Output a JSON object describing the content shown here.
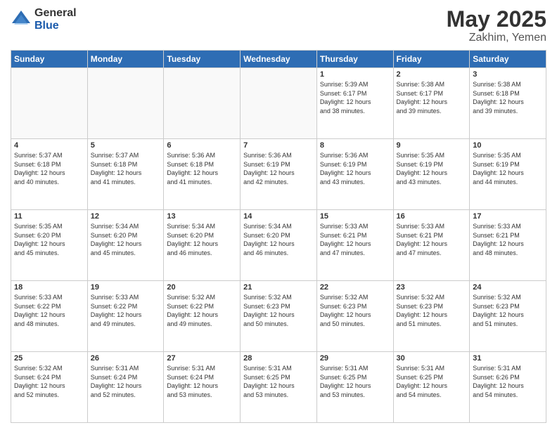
{
  "logo": {
    "general": "General",
    "blue": "Blue"
  },
  "title": "May 2025",
  "subtitle": "Zakhim, Yemen",
  "days": [
    "Sunday",
    "Monday",
    "Tuesday",
    "Wednesday",
    "Thursday",
    "Friday",
    "Saturday"
  ],
  "weeks": [
    [
      {
        "day": "",
        "info": ""
      },
      {
        "day": "",
        "info": ""
      },
      {
        "day": "",
        "info": ""
      },
      {
        "day": "",
        "info": ""
      },
      {
        "day": "1",
        "info": "Sunrise: 5:39 AM\nSunset: 6:17 PM\nDaylight: 12 hours\nand 38 minutes."
      },
      {
        "day": "2",
        "info": "Sunrise: 5:38 AM\nSunset: 6:17 PM\nDaylight: 12 hours\nand 39 minutes."
      },
      {
        "day": "3",
        "info": "Sunrise: 5:38 AM\nSunset: 6:18 PM\nDaylight: 12 hours\nand 39 minutes."
      }
    ],
    [
      {
        "day": "4",
        "info": "Sunrise: 5:37 AM\nSunset: 6:18 PM\nDaylight: 12 hours\nand 40 minutes."
      },
      {
        "day": "5",
        "info": "Sunrise: 5:37 AM\nSunset: 6:18 PM\nDaylight: 12 hours\nand 41 minutes."
      },
      {
        "day": "6",
        "info": "Sunrise: 5:36 AM\nSunset: 6:18 PM\nDaylight: 12 hours\nand 41 minutes."
      },
      {
        "day": "7",
        "info": "Sunrise: 5:36 AM\nSunset: 6:19 PM\nDaylight: 12 hours\nand 42 minutes."
      },
      {
        "day": "8",
        "info": "Sunrise: 5:36 AM\nSunset: 6:19 PM\nDaylight: 12 hours\nand 43 minutes."
      },
      {
        "day": "9",
        "info": "Sunrise: 5:35 AM\nSunset: 6:19 PM\nDaylight: 12 hours\nand 43 minutes."
      },
      {
        "day": "10",
        "info": "Sunrise: 5:35 AM\nSunset: 6:19 PM\nDaylight: 12 hours\nand 44 minutes."
      }
    ],
    [
      {
        "day": "11",
        "info": "Sunrise: 5:35 AM\nSunset: 6:20 PM\nDaylight: 12 hours\nand 45 minutes."
      },
      {
        "day": "12",
        "info": "Sunrise: 5:34 AM\nSunset: 6:20 PM\nDaylight: 12 hours\nand 45 minutes."
      },
      {
        "day": "13",
        "info": "Sunrise: 5:34 AM\nSunset: 6:20 PM\nDaylight: 12 hours\nand 46 minutes."
      },
      {
        "day": "14",
        "info": "Sunrise: 5:34 AM\nSunset: 6:20 PM\nDaylight: 12 hours\nand 46 minutes."
      },
      {
        "day": "15",
        "info": "Sunrise: 5:33 AM\nSunset: 6:21 PM\nDaylight: 12 hours\nand 47 minutes."
      },
      {
        "day": "16",
        "info": "Sunrise: 5:33 AM\nSunset: 6:21 PM\nDaylight: 12 hours\nand 47 minutes."
      },
      {
        "day": "17",
        "info": "Sunrise: 5:33 AM\nSunset: 6:21 PM\nDaylight: 12 hours\nand 48 minutes."
      }
    ],
    [
      {
        "day": "18",
        "info": "Sunrise: 5:33 AM\nSunset: 6:22 PM\nDaylight: 12 hours\nand 48 minutes."
      },
      {
        "day": "19",
        "info": "Sunrise: 5:33 AM\nSunset: 6:22 PM\nDaylight: 12 hours\nand 49 minutes."
      },
      {
        "day": "20",
        "info": "Sunrise: 5:32 AM\nSunset: 6:22 PM\nDaylight: 12 hours\nand 49 minutes."
      },
      {
        "day": "21",
        "info": "Sunrise: 5:32 AM\nSunset: 6:23 PM\nDaylight: 12 hours\nand 50 minutes."
      },
      {
        "day": "22",
        "info": "Sunrise: 5:32 AM\nSunset: 6:23 PM\nDaylight: 12 hours\nand 50 minutes."
      },
      {
        "day": "23",
        "info": "Sunrise: 5:32 AM\nSunset: 6:23 PM\nDaylight: 12 hours\nand 51 minutes."
      },
      {
        "day": "24",
        "info": "Sunrise: 5:32 AM\nSunset: 6:23 PM\nDaylight: 12 hours\nand 51 minutes."
      }
    ],
    [
      {
        "day": "25",
        "info": "Sunrise: 5:32 AM\nSunset: 6:24 PM\nDaylight: 12 hours\nand 52 minutes."
      },
      {
        "day": "26",
        "info": "Sunrise: 5:31 AM\nSunset: 6:24 PM\nDaylight: 12 hours\nand 52 minutes."
      },
      {
        "day": "27",
        "info": "Sunrise: 5:31 AM\nSunset: 6:24 PM\nDaylight: 12 hours\nand 53 minutes."
      },
      {
        "day": "28",
        "info": "Sunrise: 5:31 AM\nSunset: 6:25 PM\nDaylight: 12 hours\nand 53 minutes."
      },
      {
        "day": "29",
        "info": "Sunrise: 5:31 AM\nSunset: 6:25 PM\nDaylight: 12 hours\nand 53 minutes."
      },
      {
        "day": "30",
        "info": "Sunrise: 5:31 AM\nSunset: 6:25 PM\nDaylight: 12 hours\nand 54 minutes."
      },
      {
        "day": "31",
        "info": "Sunrise: 5:31 AM\nSunset: 6:26 PM\nDaylight: 12 hours\nand 54 minutes."
      }
    ]
  ]
}
